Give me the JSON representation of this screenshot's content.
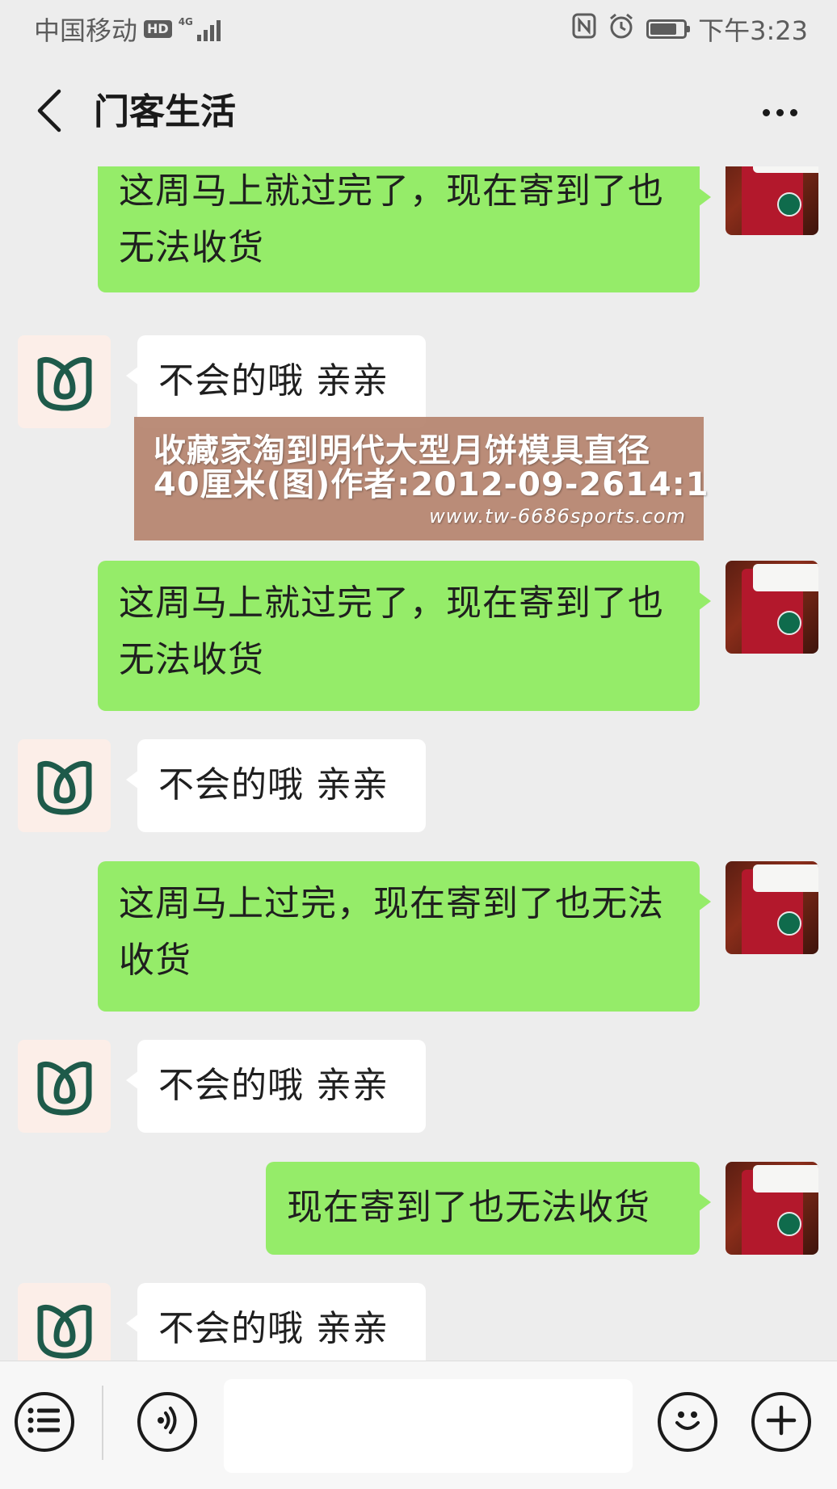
{
  "status_bar": {
    "carrier": "中国移动",
    "hd": "HD",
    "network": "4G",
    "time": "下午3:23",
    "battery_level": 0.8,
    "icons": [
      "nfc-icon",
      "alarm-icon",
      "battery-icon"
    ]
  },
  "nav": {
    "title": "门客生活",
    "back_icon": "chevron-left-icon",
    "more_icon": "more-dots-icon"
  },
  "messages": [
    {
      "side": "right",
      "text": "这周马上就过完了，现在寄到了也无法收货"
    },
    {
      "side": "left",
      "text": "不会的哦 亲亲"
    },
    {
      "side": "right",
      "text": "这周马上就过完了，现在寄到了也无法收货"
    },
    {
      "side": "left",
      "text": "不会的哦 亲亲"
    },
    {
      "side": "right",
      "text": "这周马上过完，现在寄到了也无法收货"
    },
    {
      "side": "left",
      "text": "不会的哦 亲亲"
    },
    {
      "side": "right",
      "text": "现在寄到了也无法收货"
    },
    {
      "side": "left",
      "text": "不会的哦 亲亲"
    }
  ],
  "watermark": {
    "line1": "收藏家淘到明代大型月饼模具直径",
    "line2": "40厘米(图)作者:2012-09-2614:1",
    "url": "www.tw-6686sports.com"
  },
  "input_bar": {
    "menu_icon": "menu-list-icon",
    "voice_icon": "voice-icon",
    "text_value": "",
    "emoji_icon": "emoji-icon",
    "plus_icon": "plus-icon"
  },
  "colors": {
    "background": "#ededed",
    "bubble_sent": "#95ec69",
    "bubble_received": "#ffffff",
    "bot_avatar_bg": "#fceee8",
    "bot_avatar_icon": "#1e5a4a"
  }
}
